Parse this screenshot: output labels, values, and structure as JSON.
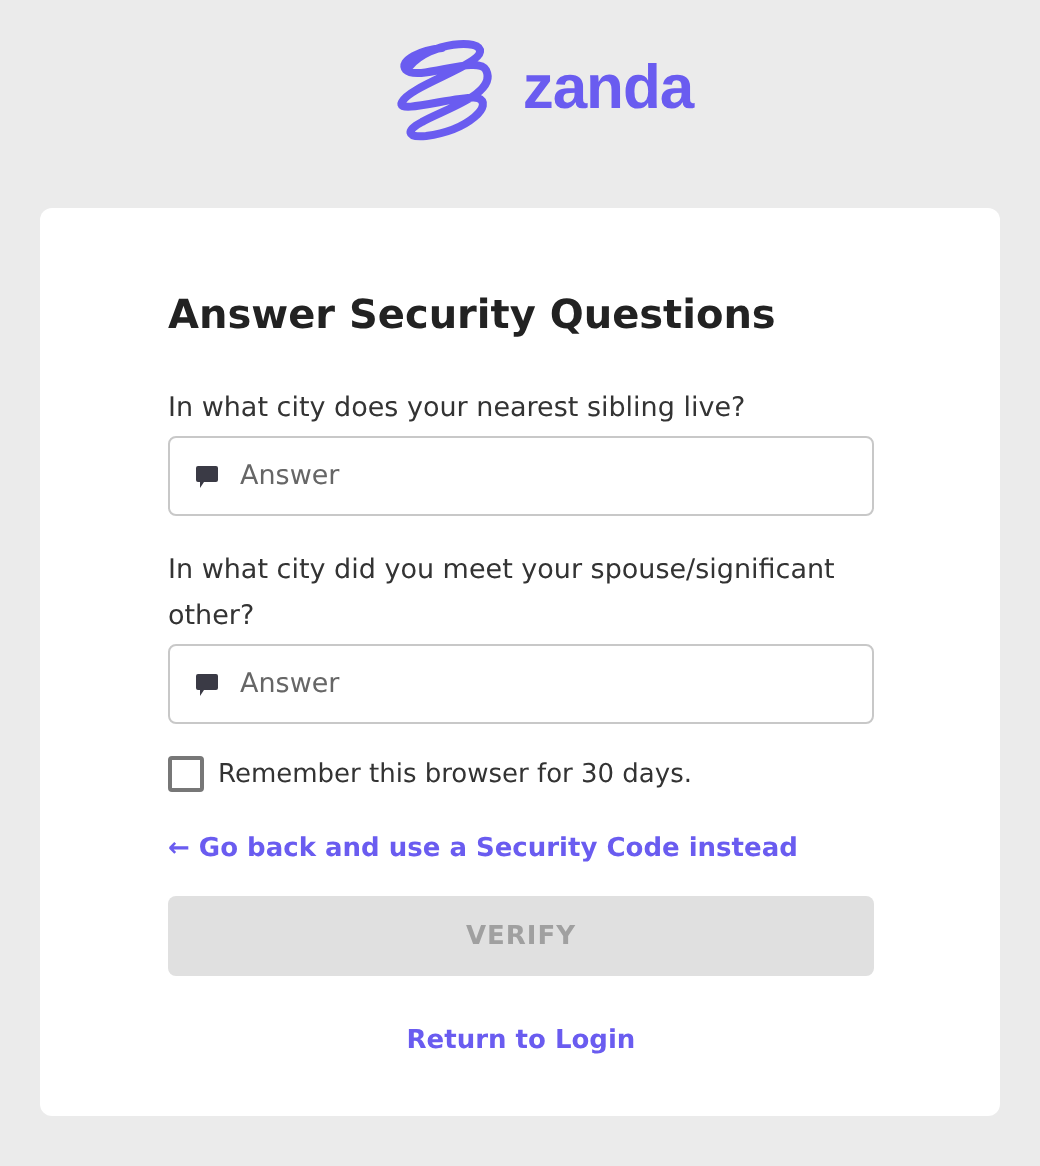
{
  "logo": {
    "text": "zanda"
  },
  "card": {
    "title": "Answer Security Questions",
    "questions": [
      {
        "label": "In what city does your nearest sibling live?",
        "placeholder": "Answer"
      },
      {
        "label": "In what city did you meet your spouse/significant other?",
        "placeholder": "Answer"
      }
    ],
    "remember": {
      "label": "Remember this browser for 30 days.",
      "checked": false
    },
    "back_link": "← Go back and use a Security Code instead",
    "verify_button": {
      "label": "VERIFY",
      "disabled": true
    },
    "return_link": "Return to Login"
  }
}
